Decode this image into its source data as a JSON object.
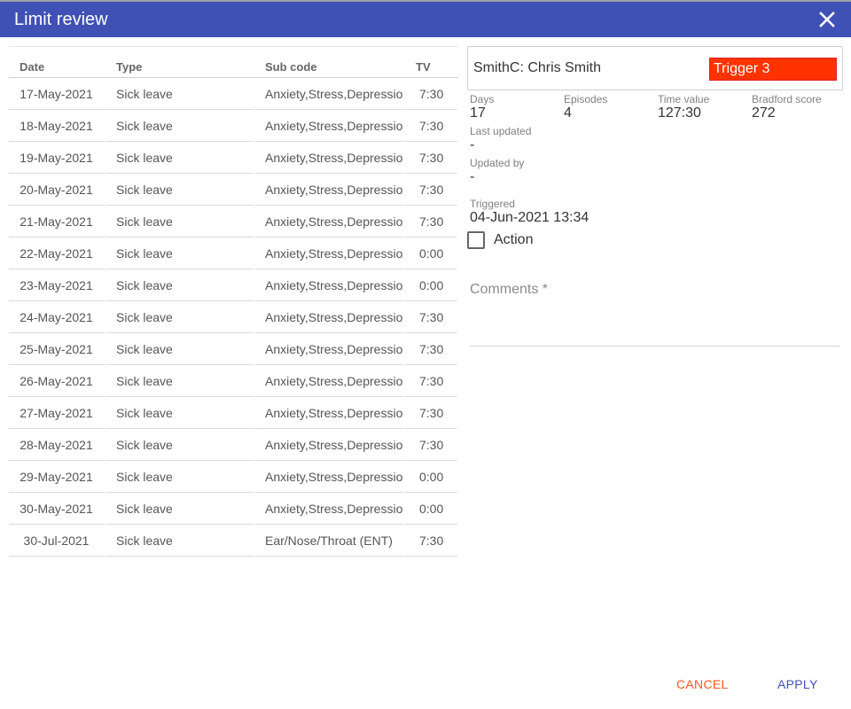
{
  "dialog": {
    "title": "Limit review",
    "close_icon": "close-icon"
  },
  "table": {
    "headers": {
      "date": "Date",
      "type": "Type",
      "sub_code": "Sub code",
      "tv": "TV"
    },
    "rows": [
      {
        "date": "17-May-2021",
        "type": "Sick leave",
        "sub_code": "Anxiety,Stress,Depression",
        "tv": "7:30"
      },
      {
        "date": "18-May-2021",
        "type": "Sick leave",
        "sub_code": "Anxiety,Stress,Depression",
        "tv": "7:30"
      },
      {
        "date": "19-May-2021",
        "type": "Sick leave",
        "sub_code": "Anxiety,Stress,Depression",
        "tv": "7:30"
      },
      {
        "date": "20-May-2021",
        "type": "Sick leave",
        "sub_code": "Anxiety,Stress,Depression",
        "tv": "7:30"
      },
      {
        "date": "21-May-2021",
        "type": "Sick leave",
        "sub_code": "Anxiety,Stress,Depression",
        "tv": "7:30"
      },
      {
        "date": "22-May-2021",
        "type": "Sick leave",
        "sub_code": "Anxiety,Stress,Depression",
        "tv": "0:00"
      },
      {
        "date": "23-May-2021",
        "type": "Sick leave",
        "sub_code": "Anxiety,Stress,Depression",
        "tv": "0:00"
      },
      {
        "date": "24-May-2021",
        "type": "Sick leave",
        "sub_code": "Anxiety,Stress,Depression",
        "tv": "7:30"
      },
      {
        "date": "25-May-2021",
        "type": "Sick leave",
        "sub_code": "Anxiety,Stress,Depression",
        "tv": "7:30"
      },
      {
        "date": "26-May-2021",
        "type": "Sick leave",
        "sub_code": "Anxiety,Stress,Depression",
        "tv": "7:30"
      },
      {
        "date": "27-May-2021",
        "type": "Sick leave",
        "sub_code": "Anxiety,Stress,Depression",
        "tv": "7:30"
      },
      {
        "date": "28-May-2021",
        "type": "Sick leave",
        "sub_code": "Anxiety,Stress,Depression",
        "tv": "7:30"
      },
      {
        "date": "29-May-2021",
        "type": "Sick leave",
        "sub_code": "Anxiety,Stress,Depression",
        "tv": "0:00"
      },
      {
        "date": "30-May-2021",
        "type": "Sick leave",
        "sub_code": "Anxiety,Stress,Depression",
        "tv": "0:00"
      },
      {
        "date": "30-Jul-2021",
        "type": "Sick leave",
        "sub_code": "Ear/Nose/Throat (ENT)",
        "tv": "7:30"
      }
    ]
  },
  "summary": {
    "person": "SmithC: Chris Smith",
    "trigger": "Trigger 3",
    "trigger_color": "#ff3300",
    "days_label": "Days",
    "days": "17",
    "episodes_label": "Episodes",
    "episodes": "4",
    "time_value_label": "Time value",
    "time_value": "127:30",
    "bradford_label": "Bradford score",
    "bradford": "272",
    "last_updated_label": "Last updated",
    "last_updated": "-",
    "updated_by_label": "Updated by",
    "updated_by": "-",
    "triggered_label": "Triggered",
    "triggered": "04-Jun-2021 13:34",
    "action_label": "Action",
    "action_checked": false,
    "comments_label": "Comments *",
    "comments_value": ""
  },
  "footer": {
    "cancel_label": "CANCEL",
    "apply_label": "APPLY"
  },
  "colors": {
    "header_bar": "#3f51b5",
    "cancel": "#ff5722",
    "apply": "#3f51b5"
  }
}
